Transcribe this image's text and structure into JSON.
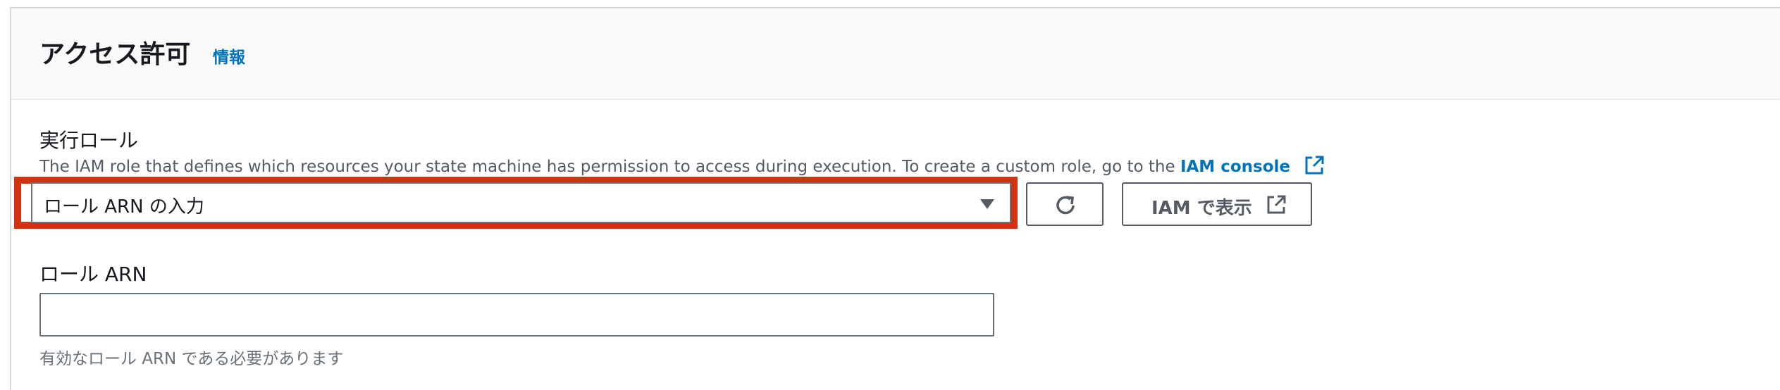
{
  "header": {
    "title": "アクセス許可",
    "info_link": "情報"
  },
  "execution_role": {
    "label": "実行ロール",
    "description": "The IAM role that defines which resources your state machine has permission to access during execution. To create a custom role, go to the",
    "console_link": "IAM console",
    "select_value": "ロール ARN の入力",
    "view_in_iam_label": "IAM で表示"
  },
  "role_arn": {
    "label": "ロール ARN",
    "value": "",
    "help_text": "有効なロール ARN である必要があります"
  },
  "colors": {
    "highlight": "#d13212",
    "link": "#0073bb",
    "text": "#16191f",
    "secondary_text": "#545b64"
  },
  "icons": {
    "external_link": "external-link-icon",
    "refresh": "refresh-icon",
    "caret": "caret-down-icon"
  }
}
